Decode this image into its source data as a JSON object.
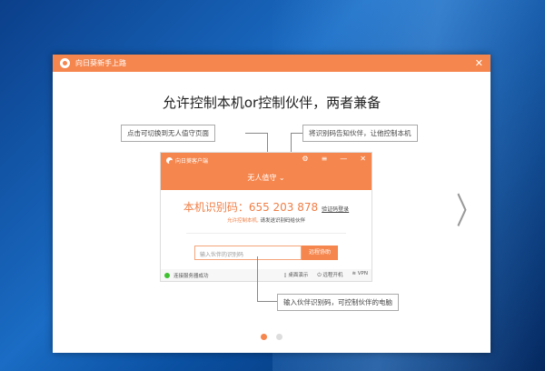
{
  "dialog": {
    "title": "向日葵新手上路",
    "close": "✕",
    "heading": "允许控制本机or控制伙伴，两者兼备",
    "next": "〉"
  },
  "notes": {
    "left": "点击可切换到无人值守页面",
    "right": "将识别码告知伙伴，让他控制本机",
    "bottom": "输入伙伴识别码，可控制伙伴的电脑"
  },
  "client": {
    "title": "向日葵客户端",
    "icons": {
      "settings": "⚙",
      "menu": "≡",
      "minimize": "—",
      "close": "✕"
    },
    "mode": "无人值守",
    "mode_icon": "⌄",
    "id_label": "本机识别码：655 203 878",
    "verify": "验证码登录",
    "allow": "允许控制本机,",
    "allow_hint": "请发送识别码给伙伴",
    "input_placeholder": "输入伙伴的识别码",
    "remote_btn": "远程协助",
    "status": "连接服务器成功",
    "desktop": "▯ 桌面演示",
    "wake": "⏻ 远程开机",
    "vpn": "≋ VPN"
  },
  "pager": {
    "pages": 2,
    "current": 1
  },
  "colors": {
    "accent": "#f5864d"
  }
}
